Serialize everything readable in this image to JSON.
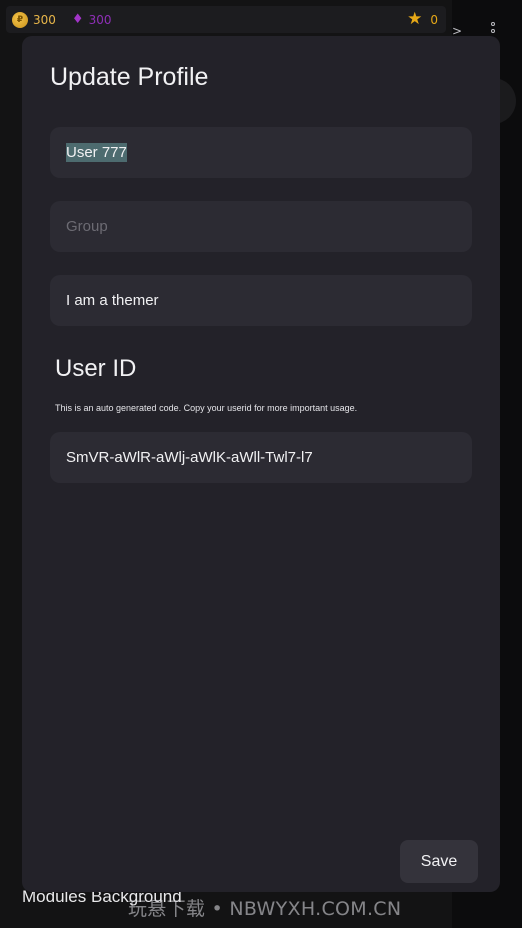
{
  "status_bar": {
    "coins": "300",
    "gems": "300",
    "stars": "0"
  },
  "background": {
    "modules_label": "Modules Background"
  },
  "watermark": "玩悬下载 • NBWYXH.COM.CN",
  "modal": {
    "title": "Update Profile",
    "username_value": "User 777",
    "group_placeholder": "Group",
    "bio_value": "I am a themer",
    "user_id_title": "User ID",
    "user_id_description": "This is an auto generated code. Copy your userid for more important usage.",
    "user_id_value": "SmVR-aWlR-aWlj-aWlK-aWll-Twl7-l7",
    "save_label": "Save"
  },
  "colors": {
    "modal_bg": "#232229",
    "field_bg": "#2c2b33",
    "selection": "#4d6b6f",
    "coin": "#e8b64a",
    "gem": "#8e2fb6",
    "star": "#e6a817"
  }
}
